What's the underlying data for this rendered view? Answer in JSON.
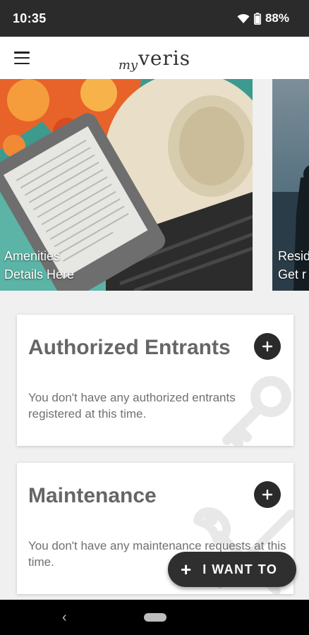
{
  "status_bar": {
    "time": "10:35",
    "battery": "88%",
    "icons": [
      "wifi-icon",
      "battery-icon"
    ]
  },
  "app_bar": {
    "menu_icon": "hamburger-menu-icon",
    "logo_prefix": "my",
    "logo_name": "veris"
  },
  "carousel": {
    "slides": [
      {
        "line1": "Amenities",
        "line2": "Details Here"
      },
      {
        "line1": "Resid",
        "line2": "Get r"
      }
    ]
  },
  "cards": {
    "entrants": {
      "title": "Authorized Entrants",
      "body": "You don't have any authorized entrants registered at this time.",
      "add_icon": "plus-icon",
      "watermark_icon": "key-icon"
    },
    "maintenance": {
      "title": "Maintenance",
      "body": "You don't have any maintenance requests at this time.",
      "add_icon": "plus-icon",
      "watermark_icon": "wrench-icon"
    }
  },
  "fab": {
    "icon": "+",
    "label": "I WANT TO"
  },
  "nav_bar": {
    "back_icon": "‹"
  },
  "colors": {
    "status_bar": "#2b2b2b",
    "app_bar": "#ffffff",
    "background": "#f0f0f0",
    "card_title": "#666666",
    "card_body": "#707070",
    "button_dark": "#2a2a2a"
  }
}
